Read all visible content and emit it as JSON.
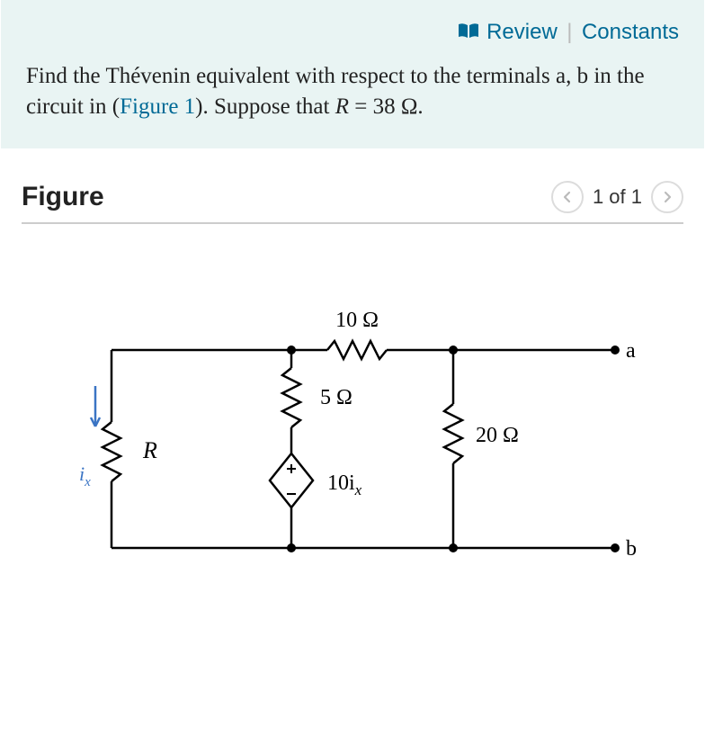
{
  "header": {
    "review_label": "Review",
    "constants_label": "Constants"
  },
  "prompt": {
    "text_before_fig": "Find the Thévenin equivalent with respect to the terminals a, b in the circuit in (",
    "figure_link": "Figure 1",
    "text_after_fig": "). Suppose that ",
    "equation_lhs": "R",
    "equation_eq": " = 38 Ω."
  },
  "figure": {
    "title": "Figure",
    "pager_text": "1 of 1"
  },
  "circuit": {
    "r_top": "10 Ω",
    "r_mid": "5 Ω",
    "r_left": "R",
    "r_right": "20 Ω",
    "source": "10i",
    "source_sub": "x",
    "ix_label": "i",
    "ix_sub": "x",
    "term_a": "a",
    "term_b": "b"
  }
}
